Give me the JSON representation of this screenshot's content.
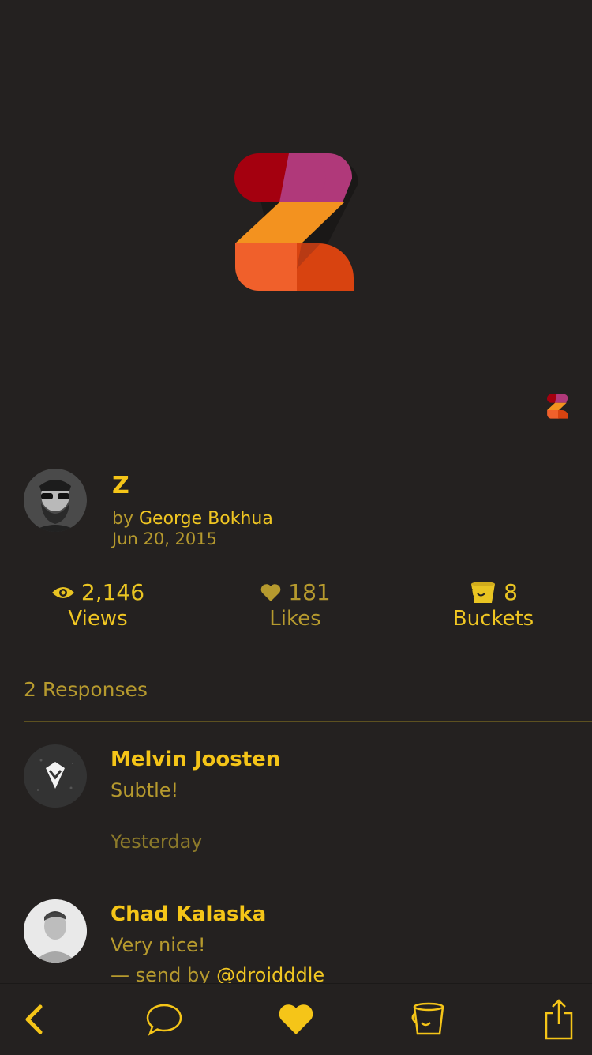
{
  "shot": {
    "title": "Z",
    "by_prefix": "by",
    "author": "George Bokhua",
    "date": "Jun 20, 2015"
  },
  "stats": {
    "views": {
      "value": "2,146",
      "label": "Views",
      "icon": "eye-icon"
    },
    "likes": {
      "value": "181",
      "label": "Likes",
      "icon": "heart-icon"
    },
    "buckets": {
      "value": "8",
      "label": "Buckets",
      "icon": "bucket-icon"
    }
  },
  "responses": {
    "title": "2 Responses",
    "items": [
      {
        "name": "Melvin Joosten",
        "text": "Subtle!",
        "time": "Yesterday"
      },
      {
        "name": "Chad Kalaska",
        "text": "Very nice!",
        "send_prefix": "— send by",
        "send_handle": "@droidddle"
      }
    ]
  },
  "tabbar": {
    "icons": [
      "back-icon",
      "comment-icon",
      "like-icon",
      "bucket-icon",
      "share-icon"
    ]
  },
  "colors": {
    "background": "#242120",
    "accent": "#f5c518",
    "muted": "#b69a2e"
  }
}
